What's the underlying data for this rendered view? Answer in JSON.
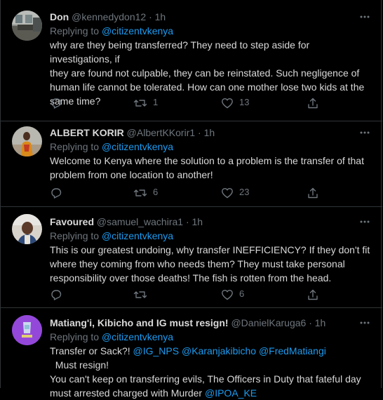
{
  "tweets": [
    {
      "name": "Don",
      "handle": "@kennedydon12",
      "separator": " · ",
      "time": "1h",
      "replying_to_label": "Replying to ",
      "replying_to_handle": "@citizentvkenya",
      "text_lines": [
        "why are they being transferred? They need to step aside for investigations, if",
        "they are found not culpable, they can be reinstated. Such negligence of",
        "human life cannot be tolerated. How can one mother lose two kids at the",
        "same time?"
      ],
      "retweets": "1",
      "likes": "13"
    },
    {
      "name": "ALBERT KORIR",
      "handle": "@AlbertKKorir1",
      "separator": " · ",
      "time": "1h",
      "replying_to_label": "Replying to ",
      "replying_to_handle": "@citizentvkenya",
      "text_lines": [
        "Welcome to Kenya where the solution to a problem is the transfer of that",
        "problem from one location to another!"
      ],
      "retweets": "6",
      "likes": "23"
    },
    {
      "name": "Favoured",
      "handle": "@samuel_wachira1",
      "separator": " · ",
      "time": "1h",
      "replying_to_label": "Replying to ",
      "replying_to_handle": "@citizentvkenya",
      "text_lines": [
        "This is our greatest undoing, why transfer INEFFICIENCY? If they don't fit",
        "where they coming from who needs them? They must take personal",
        "responsibility over those deaths! The fish is rotten from the head."
      ],
      "retweets": "",
      "likes": "6"
    },
    {
      "name": "Matiang'i, Kibicho and IG must resign!",
      "handle": "@DanielKaruga6",
      "separator": " · ",
      "time": "1h",
      "replying_to_label": "Replying to ",
      "replying_to_handle": "@citizentvkenya",
      "line1_pre": "Transfer or Sack?! ",
      "mention1": "@IG_NPS",
      "mention2": "@Karanjakibicho",
      "mention3": "@FredMatiangi",
      "line1_post": "  Must resign!",
      "line2": "You can't keep on transferring evils, The Officers in Duty that fateful day",
      "line3_pre": "must arrested charged with Murder ",
      "mention4": "@IPOA_KE"
    }
  ],
  "icons": {
    "reply": "reply-icon",
    "retweet": "retweet-icon",
    "like": "heart-icon",
    "share": "share-icon",
    "more": "more-icon"
  },
  "colors": {
    "background": "#000000",
    "text": "#d9d9d9",
    "muted": "#6e767d",
    "link": "#1d9bf0",
    "border": "#2f3336"
  }
}
